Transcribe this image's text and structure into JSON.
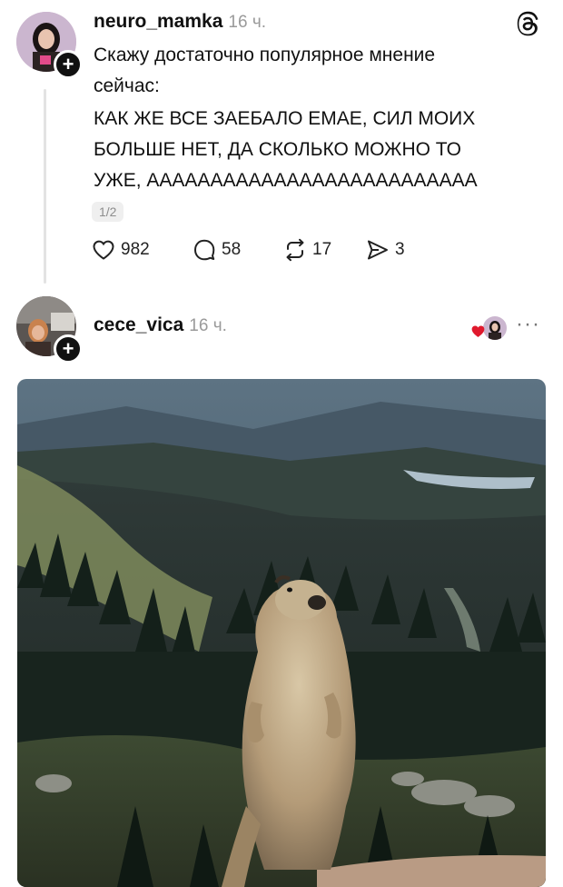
{
  "post1": {
    "username": "neuro_mamka",
    "time": "16 ч.",
    "text_line1": "Скажу достаточно популярное мнение",
    "text_line2": "сейчас:",
    "caps_line1": "КАК ЖЕ ВСЕ ЗАЕБАЛО ЕМАЕ, СИЛ МОИХ",
    "caps_line2": "БОЛЬШЕ НЕТ, ДА СКОЛЬКО МОЖНО ТО",
    "caps_line3": "УЖЕ, АААААААААААААААААААААААААА",
    "page_counter": "1/2",
    "likes": "982",
    "comments": "58",
    "reposts": "17",
    "shares": "3"
  },
  "post2": {
    "username": "cece_vica",
    "time": "16 ч.",
    "more": "···"
  },
  "icons": {
    "app": "threads-logo-icon",
    "like": "heart-icon",
    "comment": "comment-bubble-icon",
    "repost": "repost-icon",
    "share": "send-icon",
    "follow": "plus-icon"
  },
  "colors": {
    "accent_heart": "#e0192d",
    "muted": "#9a9a9a"
  }
}
